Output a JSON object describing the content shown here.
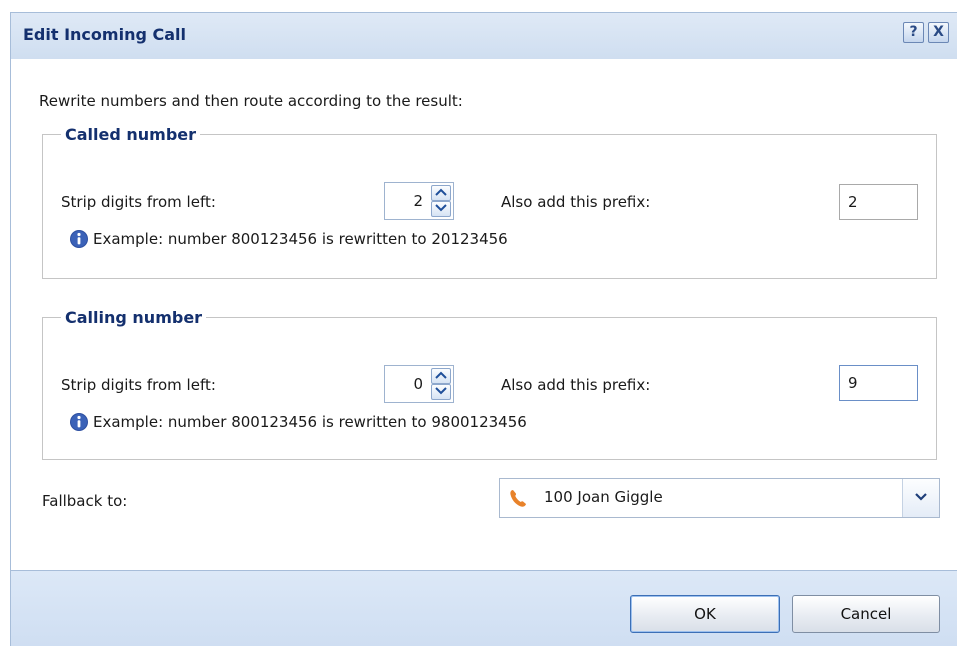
{
  "dialog": {
    "title": "Edit Incoming Call",
    "help_label": "?",
    "close_label": "X"
  },
  "intro": "Rewrite numbers and then route according to the result:",
  "called": {
    "legend": "Called number",
    "strip_label": "Strip digits from left:",
    "strip_value": "2",
    "prefix_label": "Also add this prefix:",
    "prefix_value": "2",
    "example": "Example: number 800123456 is rewritten to 20123456"
  },
  "calling": {
    "legend": "Calling number",
    "strip_label": "Strip digits from left:",
    "strip_value": "0",
    "prefix_label": "Also add this prefix:",
    "prefix_value": "9",
    "example": "Example: number 800123456 is rewritten to 9800123456"
  },
  "fallback": {
    "label": "Fallback to:",
    "selected": "100 Joan Giggle",
    "icon": "phone-icon"
  },
  "buttons": {
    "ok": "OK",
    "cancel": "Cancel"
  },
  "colors": {
    "title": "#14306e",
    "titlebar": "#cfdef0",
    "info_icon": "#2d4fa1",
    "phone_icon": "#e8822a"
  }
}
